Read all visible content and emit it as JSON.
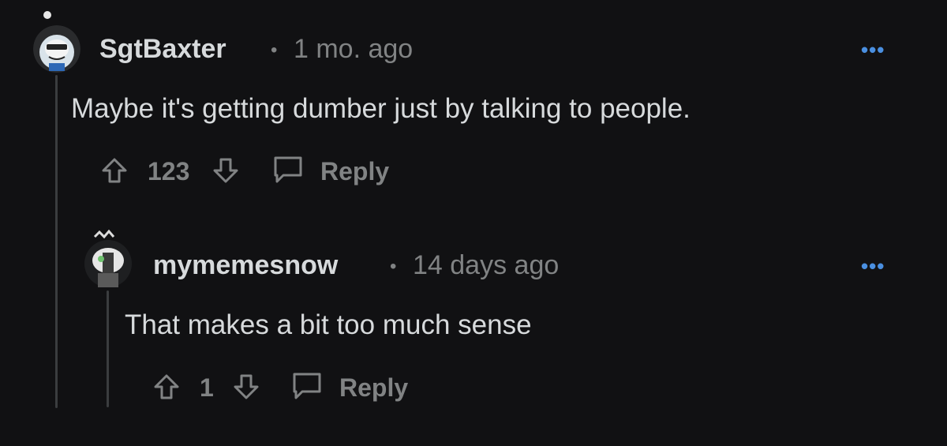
{
  "comments": [
    {
      "username": "SgtBaxter",
      "separator": "•",
      "time": "1 mo. ago",
      "more": "•••",
      "body": "Maybe it's getting dumber just by talking to people.",
      "votes": "123",
      "reply_label": "Reply"
    },
    {
      "username": "mymemesnow",
      "separator": "•",
      "time": "14 days ago",
      "more": "•••",
      "body": "That makes a bit too much sense",
      "votes": "1",
      "reply_label": "Reply"
    }
  ],
  "colors": {
    "background": "#111113",
    "text": "#d7dadc",
    "muted": "#818384",
    "accent": "#4a8fe0",
    "thread_line": "#3b3d3f"
  }
}
